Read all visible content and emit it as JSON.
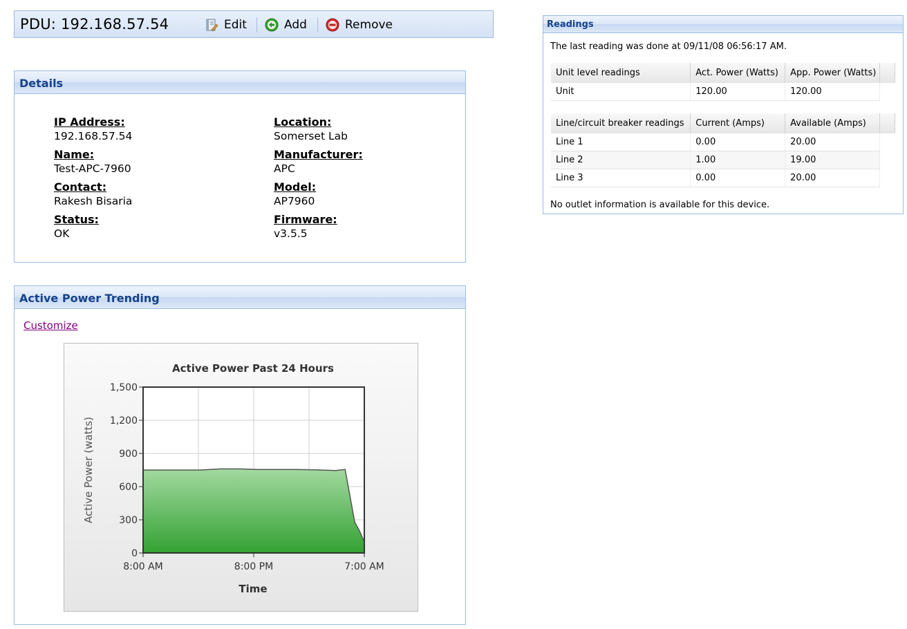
{
  "header": {
    "title": "PDU: 192.168.57.54",
    "edit_label": "Edit",
    "add_label": "Add",
    "remove_label": "Remove"
  },
  "details": {
    "heading": "Details",
    "ip_label": "IP Address:",
    "ip_value": "192.168.57.54",
    "name_label": "Name:",
    "name_value": "Test-APC-7960",
    "contact_label": "Contact:",
    "contact_value": "Rakesh Bisaria",
    "status_label": "Status:",
    "status_value": "OK",
    "location_label": "Location:",
    "location_value": "Somerset Lab",
    "manufacturer_label": "Manufacturer:",
    "manufacturer_value": "APC",
    "model_label": "Model:",
    "model_value": "AP7960",
    "firmware_label": "Firmware:",
    "firmware_value": "v3.5.5"
  },
  "trending": {
    "heading": "Active Power Trending",
    "customize_label": "Customize"
  },
  "readings": {
    "heading": "Readings",
    "last_reading": "The last reading was done at 09/11/08 06:56:17 AM.",
    "unit_headers": [
      "Unit level readings",
      "Act. Power (Watts)",
      "App. Power (Watts)"
    ],
    "unit_rows": [
      [
        "Unit",
        "120.00",
        "120.00"
      ]
    ],
    "line_headers": [
      "Line/circuit breaker readings",
      "Current (Amps)",
      "Available (Amps)"
    ],
    "line_rows": [
      [
        "Line 1",
        "0.00",
        "20.00"
      ],
      [
        "Line 2",
        "1.00",
        "19.00"
      ],
      [
        "Line 3",
        "0.00",
        "20.00"
      ]
    ],
    "no_outlet": "No outlet information is available for this device."
  },
  "chart_data": {
    "type": "area",
    "title": "Active Power Past 24 Hours",
    "xlabel": "Time",
    "ylabel": "Active Power (watts)",
    "x_tick_labels": [
      "8:00 AM",
      "8:00 PM",
      "7:00 AM"
    ],
    "y_ticks": [
      "0",
      "300",
      "600",
      "900",
      "1,200",
      "1,500"
    ],
    "ylim": [
      0,
      1500
    ],
    "xlim": [
      0,
      23
    ],
    "grid": true,
    "fill_color": "#3fae3f",
    "series": [
      {
        "x": [
          0,
          2,
          4,
          6,
          8,
          10,
          12,
          14,
          16,
          18,
          20,
          21,
          22,
          22.5,
          23
        ],
        "values": [
          750,
          750,
          750,
          750,
          760,
          760,
          755,
          755,
          755,
          752,
          745,
          755,
          280,
          200,
          100
        ]
      }
    ]
  }
}
